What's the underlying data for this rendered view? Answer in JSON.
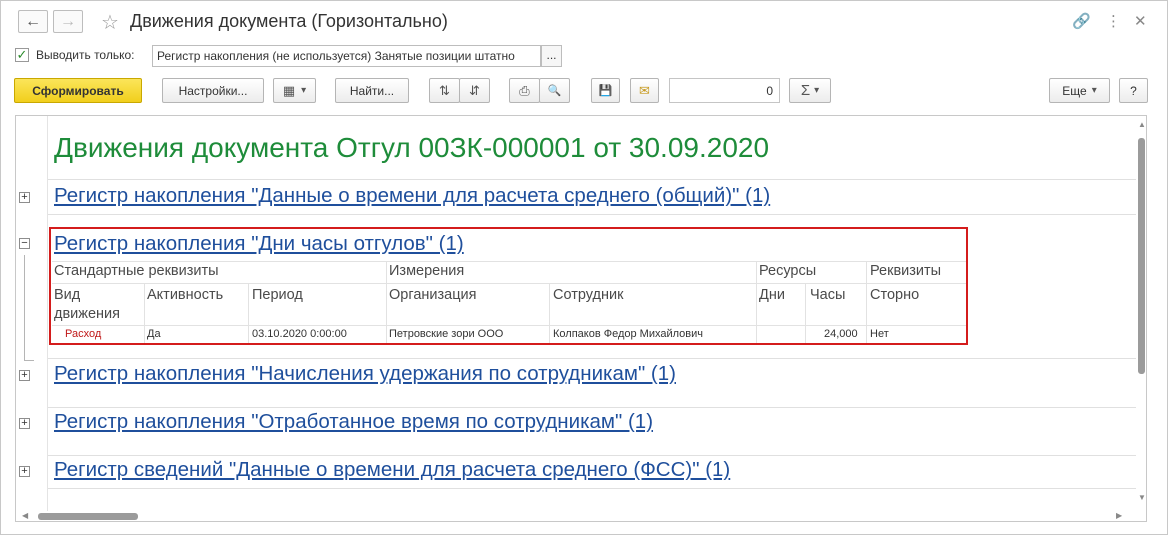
{
  "window": {
    "title": "Движения документа (Горизонтально)",
    "back_icon": "←",
    "forward_icon": "→",
    "star_icon": "☆",
    "link_icon": "🔗",
    "more_icon": "⋮",
    "close_icon": "✕"
  },
  "filter": {
    "checkbox_mark": "✓",
    "label": "Выводить только:",
    "value": "Регистр накопления (не используется) Занятые позиции штатно",
    "select_button": "..."
  },
  "toolbar": {
    "generate": "Сформировать",
    "settings": "Настройки...",
    "variant_icon": "▦",
    "dropdown_icon": "▾",
    "find": "Найти...",
    "expand_icon": "⇅",
    "collapse_icon": "⇵",
    "print_icon": "⎙",
    "preview_icon": "🔍",
    "save_icon": "💾",
    "mail_icon": "✉",
    "number_value": "0",
    "sum_icon": "Σ",
    "more": "Еще",
    "help": "?"
  },
  "report": {
    "title": "Движения документа Отгул 00ЗК-000001 от 30.09.2020",
    "registers": [
      {
        "label": "Регистр накопления \"Данные о времени для расчета среднего (общий)\" (1)",
        "toggle": "+"
      },
      {
        "label": "Регистр накопления \"Дни часы отгулов\" (1)",
        "toggle": "−"
      },
      {
        "label": "Регистр накопления \"Начисления удержания по сотрудникам\" (1)",
        "toggle": "+"
      },
      {
        "label": "Регистр накопления \"Отработанное время по сотрудникам\" (1)",
        "toggle": "+"
      },
      {
        "label": "Регистр сведений \"Данные о времени для расчета среднего (ФСС)\" (1)",
        "toggle": "+"
      }
    ],
    "table": {
      "groups": [
        "Стандартные реквизиты",
        "Измерения",
        "Ресурсы",
        "Реквизиты"
      ],
      "columns": [
        "Вид движения",
        "Активность",
        "Период",
        "Организация",
        "Сотрудник",
        "Дни",
        "Часы",
        "Сторно"
      ],
      "col1_line1": "Вид",
      "col1_line2": "движения",
      "row": {
        "movement": "Расход",
        "active": "Да",
        "period": "03.10.2020 0:00:00",
        "organization": "Петровские зори ООО",
        "employee": "Колпаков Федор Михайлович",
        "days": "",
        "hours": "24,000",
        "storno": "Нет"
      }
    }
  },
  "colors": {
    "title_green": "#1e8c3a",
    "link_blue": "#1f4f9c",
    "highlight_red": "#d41c1c",
    "primary_button": "#f1cf1c"
  }
}
